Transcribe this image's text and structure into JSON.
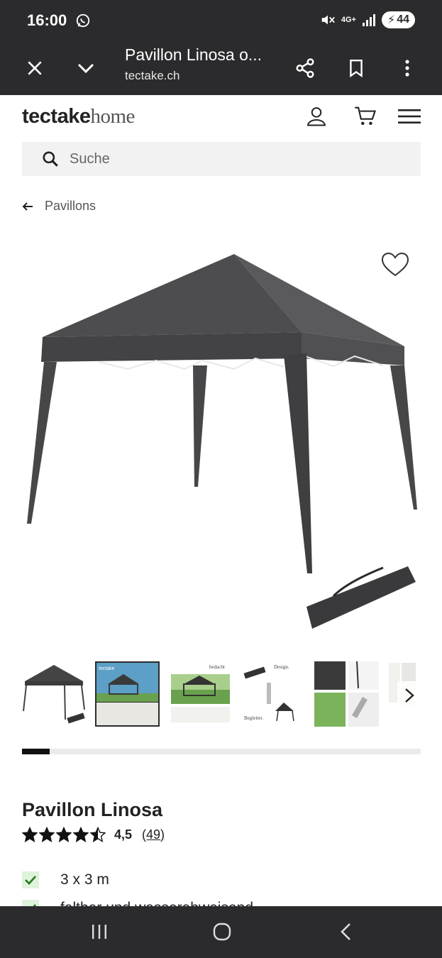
{
  "status_bar": {
    "time": "16:00",
    "network": "4G+",
    "battery": "44",
    "icons": [
      "whatsapp-icon",
      "mute-icon",
      "signal-icon",
      "battery-icon"
    ]
  },
  "browser": {
    "title": "Pavillon Linosa o...",
    "url": "tectake.ch",
    "icons": [
      "close-icon",
      "chevron-down-icon",
      "share-icon",
      "bookmark-icon",
      "more-icon"
    ]
  },
  "site": {
    "logo_bold": "tectake",
    "logo_light": "home",
    "header_icons": [
      "user-icon",
      "cart-icon",
      "menu-icon"
    ]
  },
  "search": {
    "placeholder": "Suche"
  },
  "breadcrumb": {
    "label": "Pavillons"
  },
  "gallery": {
    "thumbnail_count": 6,
    "progress_fraction": 0.07,
    "thumb_labels": [
      "tectake",
      "bedacht",
      "Design.",
      "Begleiter."
    ]
  },
  "product": {
    "title": "Pavillon Linosa",
    "rating_value": "4,5",
    "rating_count": "(49)",
    "stars": 4.5,
    "features": [
      "3 x 3 m",
      "faltbar und wasserabweisend"
    ]
  },
  "colors": {
    "chrome": "#2b2b2d",
    "tent": "#4a4a4c",
    "check_bg": "#dff3dc",
    "check": "#1f7a1f"
  }
}
